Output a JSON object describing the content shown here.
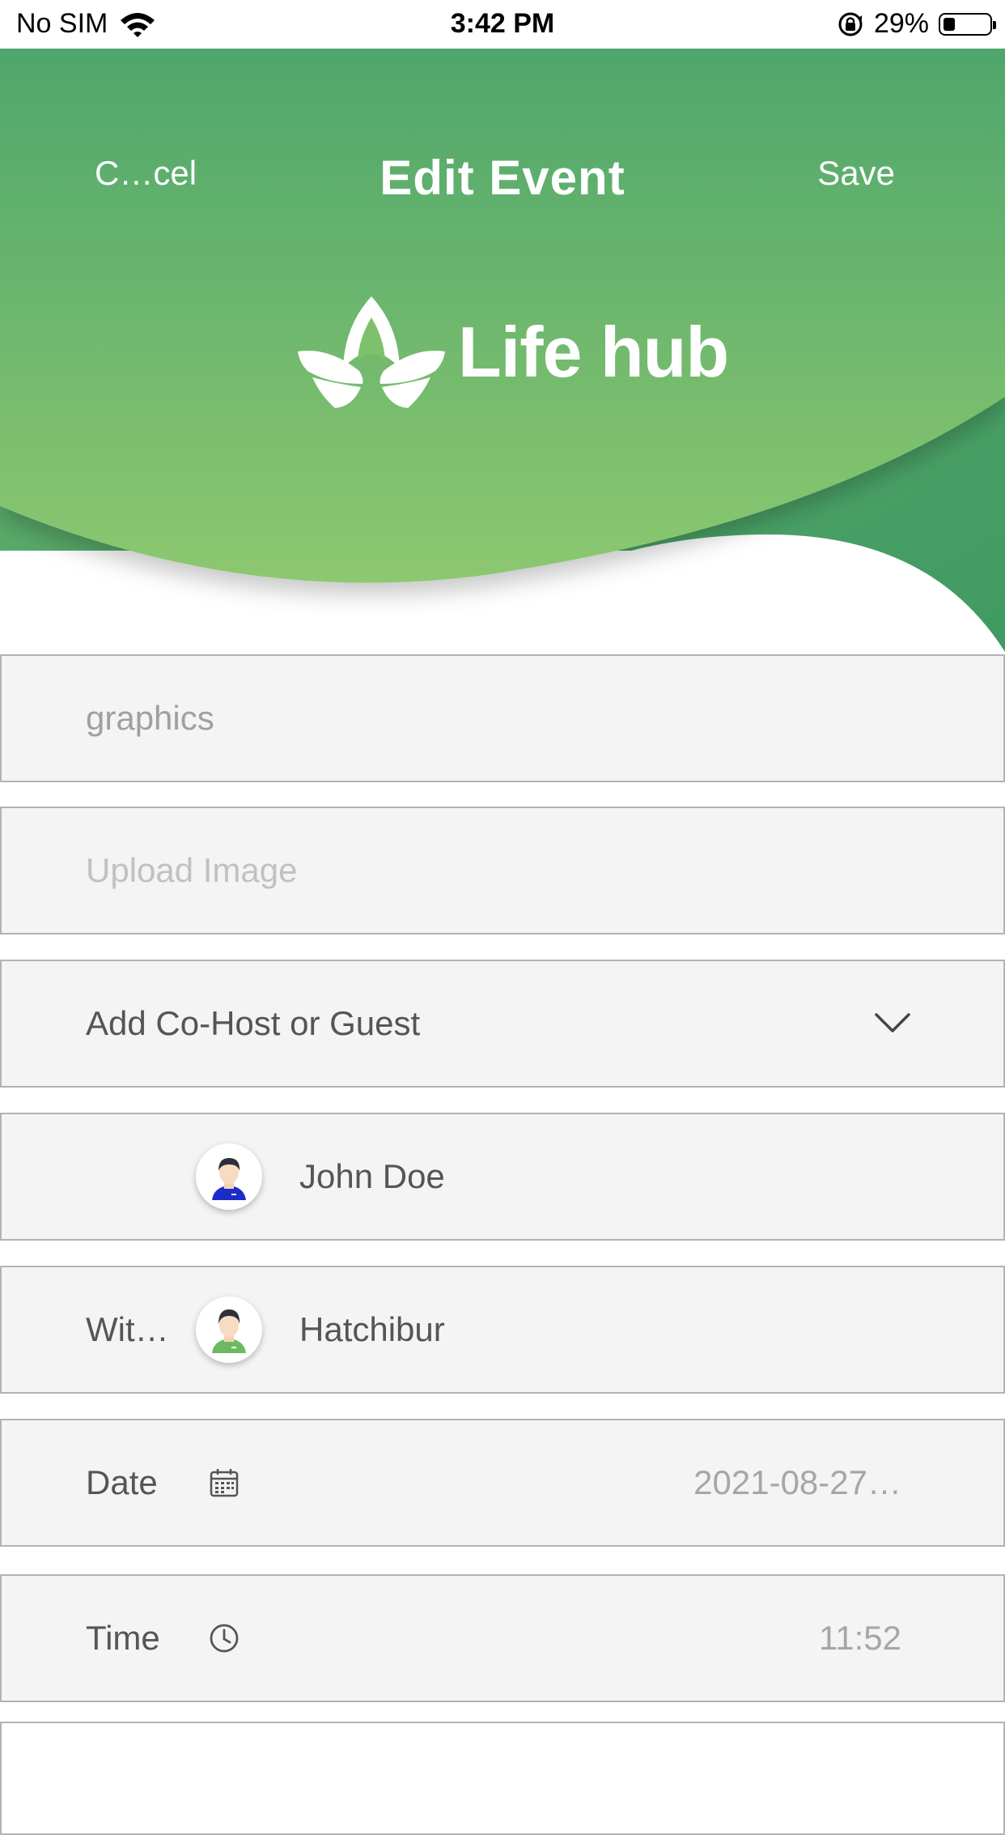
{
  "status_bar": {
    "carrier": "No SIM",
    "time": "3:42 PM",
    "battery_percent": "29%",
    "battery_level": 0.29
  },
  "nav": {
    "cancel_label": "C…cel",
    "title": "Edit Event",
    "save_label": "Save"
  },
  "brand": {
    "name": "Life hub",
    "gradient_top": "#4fa66c",
    "gradient_bottom": "#8cc86f",
    "accent_dark": "#4aa064"
  },
  "form": {
    "title_value": "graphics",
    "upload_placeholder": "Upload Image",
    "cohost_label": "Add Co-Host or Guest",
    "host": {
      "name": "John Doe"
    },
    "with": {
      "label": "Wit…",
      "name": "Hatchibur"
    },
    "date": {
      "label": "Date",
      "value": "2021-08-27…"
    },
    "time": {
      "label": "Time",
      "value": "11:52"
    }
  },
  "icons": {
    "status": [
      "wifi-icon",
      "orientation-lock-icon",
      "battery-icon"
    ],
    "cohost": "chevron-down-icon",
    "date": "calendar-icon",
    "time": "clock-icon",
    "logo": "lotus-leaf-icon"
  }
}
